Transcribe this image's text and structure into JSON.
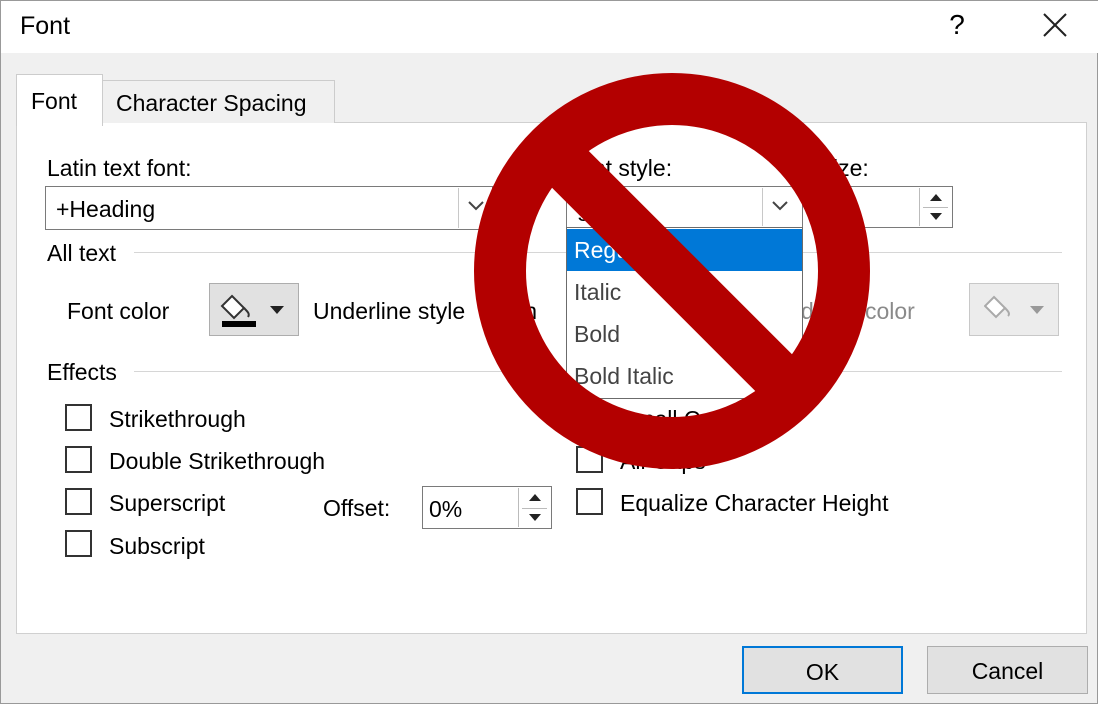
{
  "window": {
    "title": "Font",
    "help_label": "?",
    "close_icon": "close-icon"
  },
  "tabs": [
    {
      "label": "Font",
      "active": true
    },
    {
      "label": "Character Spacing",
      "active": false
    }
  ],
  "font_tab": {
    "latin_font_label": "Latin text font:",
    "latin_font_value": "+Heading",
    "font_style_label": "Font style:",
    "font_style_value": "gular",
    "size_label": "ize:",
    "size_value": "",
    "all_text_heading": "All text",
    "font_color_label": "Font color",
    "underline_style_label": "Underline style",
    "underline_style_value": "(non",
    "underline_color_label": "de    ne color",
    "effects_heading": "Effects",
    "effects": [
      {
        "label": "Strikethrough",
        "checked": false
      },
      {
        "label": "Double Strikethrough",
        "checked": false
      },
      {
        "label": "Superscript",
        "checked": false
      },
      {
        "label": "Subscript",
        "checked": false
      },
      {
        "label": "Small Cap",
        "checked": false
      },
      {
        "label": "All Caps",
        "checked": false
      },
      {
        "label": "Equalize Character Height",
        "checked": false
      }
    ],
    "offset_label": "Offset:",
    "offset_value": "0%"
  },
  "font_style_dropdown": {
    "options": [
      "Regu",
      "Italic",
      "Bold",
      "Bold Italic"
    ],
    "selected_index": 0
  },
  "buttons": {
    "ok": "OK",
    "cancel": "Cancel"
  },
  "overlay": {
    "icon": "prohibition-icon",
    "color": "#b30000"
  },
  "colors": {
    "accent": "#0078d7",
    "dialog_bg": "#f0f0f0",
    "prohibition_red": "#b30000"
  }
}
